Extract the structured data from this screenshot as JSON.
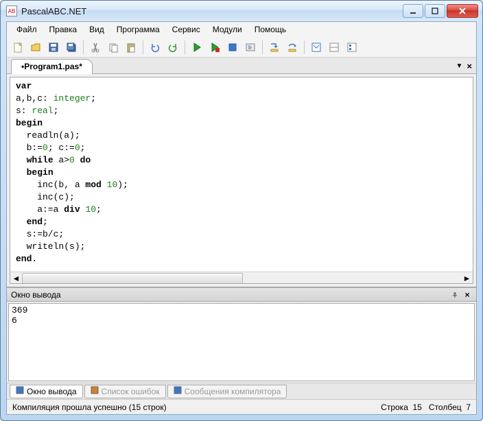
{
  "window": {
    "title": "PascalABC.NET",
    "app_icon_text": "AB"
  },
  "menu": [
    "Файл",
    "Правка",
    "Вид",
    "Программа",
    "Сервис",
    "Модули",
    "Помощь"
  ],
  "tab": {
    "label": "•Program1.pas*"
  },
  "code_tokens": [
    [
      [
        "kw",
        "var"
      ]
    ],
    [
      [
        "",
        "a,b,c: "
      ],
      [
        "type",
        "integer"
      ],
      [
        "",
        ";"
      ]
    ],
    [
      [
        "",
        "s: "
      ],
      [
        "type",
        "real"
      ],
      [
        "",
        ";"
      ]
    ],
    [
      [
        "kw",
        "begin"
      ]
    ],
    [
      [
        "",
        "  readln(a);"
      ]
    ],
    [
      [
        "",
        "  b:="
      ],
      [
        "num",
        "0"
      ],
      [
        "",
        "; c:="
      ],
      [
        "num",
        "0"
      ],
      [
        "",
        ";"
      ]
    ],
    [
      [
        "",
        "  "
      ],
      [
        "kw",
        "while"
      ],
      [
        "",
        " a>"
      ],
      [
        "num",
        "0"
      ],
      [
        "",
        " "
      ],
      [
        "kw",
        "do"
      ]
    ],
    [
      [
        "",
        "  "
      ],
      [
        "kw",
        "begin"
      ]
    ],
    [
      [
        "",
        "    inc(b, a "
      ],
      [
        "kw",
        "mod"
      ],
      [
        "",
        " "
      ],
      [
        "num",
        "10"
      ],
      [
        "",
        ");"
      ]
    ],
    [
      [
        "",
        "    inc(c);"
      ]
    ],
    [
      [
        "",
        "    a:=a "
      ],
      [
        "kw",
        "div"
      ],
      [
        "",
        " "
      ],
      [
        "num",
        "10"
      ],
      [
        "",
        ";"
      ]
    ],
    [
      [
        "",
        "  "
      ],
      [
        "kw",
        "end"
      ],
      [
        "",
        ";"
      ]
    ],
    [
      [
        "",
        "  s:=b/c;"
      ]
    ],
    [
      [
        "",
        "  writeln(s);"
      ]
    ],
    [
      [
        "kw",
        "end"
      ],
      [
        "",
        "."
      ]
    ]
  ],
  "output": {
    "title": "Окно вывода",
    "lines": [
      "369",
      "6"
    ]
  },
  "bottom_tabs": [
    {
      "label": "Окно вывода",
      "active": true,
      "icon_color": "#3a78c8"
    },
    {
      "label": "Список ошибок",
      "disabled": true,
      "icon_color": "#d08030"
    },
    {
      "label": "Сообщения компилятора",
      "disabled": true,
      "icon_color": "#3a78c8"
    }
  ],
  "status": {
    "left": "Компиляция прошла успешно (15 строк)",
    "line_label": "Строка",
    "line": "15",
    "col_label": "Столбец",
    "col": "7"
  },
  "toolbar_icons": [
    {
      "name": "new-file-icon",
      "svg": "<rect x='3' y='2' width='10' height='13' fill='#fff' stroke='#b0a060'/><path d='M10 2 L13 5 L10 5 Z' fill='#f0e0a0' stroke='#b0a060'/>"
    },
    {
      "name": "open-file-icon",
      "svg": "<path d='M2 5 L6 5 L7 3 L14 3 L14 13 L2 13 Z' fill='#f4d060' stroke='#b08020'/>"
    },
    {
      "name": "save-icon",
      "svg": "<rect x='2' y='2' width='12' height='12' fill='#4a6fb0' stroke='#2a4a80'/><rect x='4' y='3' width='8' height='4' fill='#fff'/><rect x='5' y='9' width='6' height='4' fill='#c0d0e8'/>"
    },
    {
      "name": "save-all-icon",
      "svg": "<rect x='4' y='4' width='10' height='10' fill='#4a6fb0' stroke='#2a4a80'/><rect x='2' y='2' width='10' height='10' fill='#6a8fc8' stroke='#2a4a80'/><rect x='4' y='3' width='6' height='3' fill='#fff'/>"
    },
    "sep",
    {
      "name": "cut-icon",
      "svg": "<path d='M6 2 L10 14 M10 2 L6 14' stroke='#888' stroke-width='1.5'/><circle cx='5' cy='13' r='2' fill='none' stroke='#888'/><circle cx='11' cy='13' r='2' fill='none' stroke='#888'/>"
    },
    {
      "name": "copy-icon",
      "svg": "<rect x='3' y='3' width='8' height='10' fill='#fff' stroke='#888'/><rect x='6' y='5' width='8' height='10' fill='#fff' stroke='#888'/>"
    },
    {
      "name": "paste-icon",
      "svg": "<rect x='3' y='3' width='10' height='12' fill='#d8b860' stroke='#908040'/><rect x='5' y='2' width='6' height='3' fill='#a8a8a8'/><rect x='6' y='7' width='7' height='8' fill='#fff' stroke='#888'/>"
    },
    "sep",
    {
      "name": "undo-icon",
      "svg": "<path d='M11 5 A5 5 0 1 1 4 7 M4 7 L4 3 M4 7 L8 7' fill='none' stroke='#3a78c8' stroke-width='1.5'/>"
    },
    {
      "name": "redo-icon",
      "svg": "<path d='M5 5 A5 5 0 1 0 12 7 M12 7 L12 3 M12 7 L8 7' fill='none' stroke='#2a9a2a' stroke-width='1.5'/>"
    },
    "sep",
    {
      "name": "run-icon",
      "svg": "<path d='M4 2 L13 8 L4 14 Z' fill='#2aa02a' stroke='#1a701a'/>"
    },
    {
      "name": "run-debug-icon",
      "svg": "<path d='M4 2 L13 8 L4 14 Z' fill='#2aa02a' stroke='#1a701a'/><rect x='9' y='9' width='6' height='6' fill='#c83030'/>"
    },
    {
      "name": "stop-icon",
      "svg": "<rect x='3' y='3' width='10' height='10' fill='#3a78c8' stroke='#2a58a0'/>"
    },
    {
      "name": "compile-icon",
      "svg": "<rect x='2' y='3' width='12' height='10' fill='#e8e8e8' stroke='#888'/><path d='M5 6 L8 6 M5 8 L10 8 M5 10 L9 10' stroke='#3a78c8'/>"
    },
    "sep",
    {
      "name": "step-into-icon",
      "svg": "<path d='M3 3 L10 3 L10 8' stroke='#3a78c8' fill='none' stroke-width='1.5'/><path d='M7 6 L10 9 L13 6' fill='#3a78c8'/><rect x='3' y='11' width='10' height='3' fill='#f0d060' stroke='#b09030'/>"
    },
    {
      "name": "step-over-icon",
      "svg": "<path d='M3 6 Q8 1 13 6' stroke='#3a78c8' fill='none' stroke-width='1.5'/><path d='M11 4 L14 6 L11 8' fill='#3a78c8'/><rect x='3' y='11' width='10' height='3' fill='#f0d060' stroke='#b09030'/>"
    },
    "sep",
    {
      "name": "toggle-output-icon",
      "svg": "<rect x='2' y='2' width='12' height='12' fill='#fff' stroke='#3a78c8'/><path d='M4 5 L8 9 L12 5' stroke='#3a78c8' fill='none'/>"
    },
    {
      "name": "toggle-errors-icon",
      "svg": "<rect x='2' y='2' width='12' height='12' fill='#fff' stroke='#888'/><path d='M2 8 L14 8' stroke='#888'/>"
    },
    {
      "name": "properties-icon",
      "svg": "<rect x='2' y='2' width='12' height='12' fill='#fff' stroke='#888'/><rect x='4' y='4' width='3' height='3' fill='#3a78c8'/><rect x='4' y='9' width='3' height='3' fill='#3a78c8'/>"
    }
  ]
}
